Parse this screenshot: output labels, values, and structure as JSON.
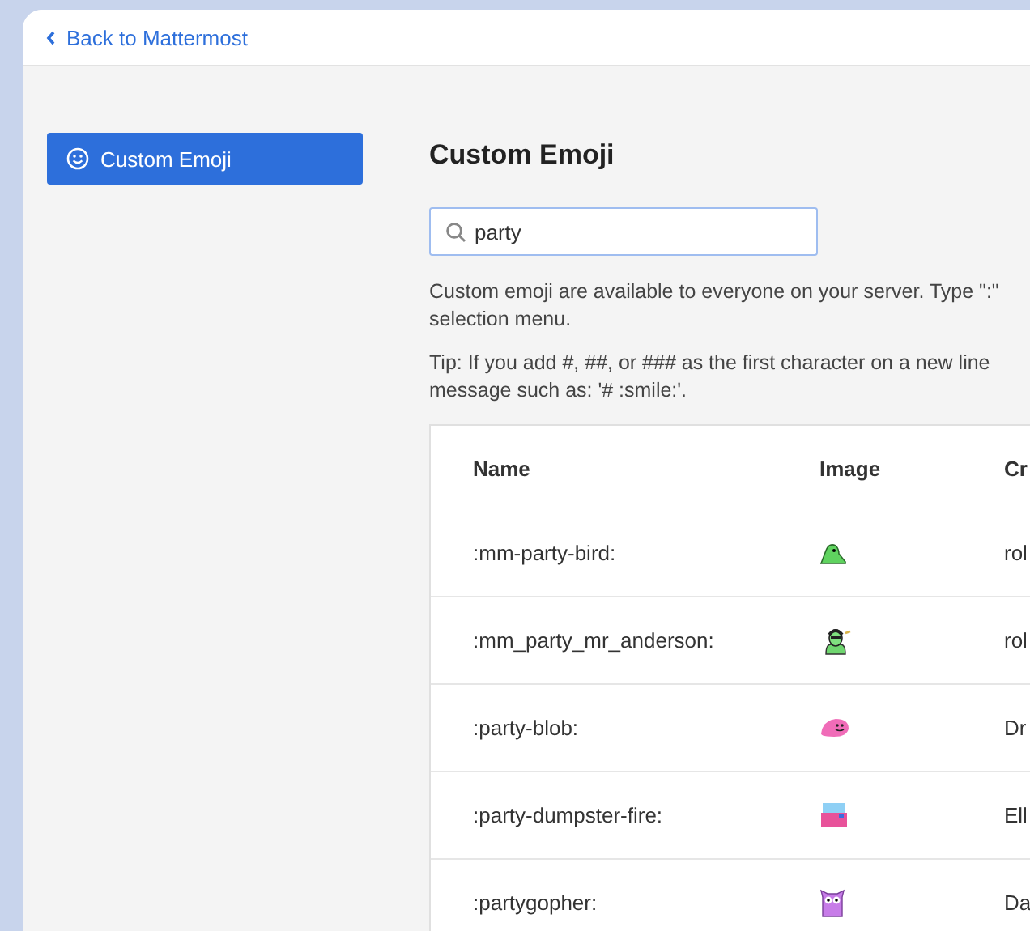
{
  "header": {
    "back_link": "Back to Mattermost"
  },
  "sidebar": {
    "items": [
      {
        "label": "Custom Emoji",
        "selected": true
      }
    ]
  },
  "main": {
    "title": "Custom Emoji",
    "search": {
      "value": "party"
    },
    "description_lines": [
      "Custom emoji are available to everyone on your server. Type \":\"",
      "selection menu."
    ],
    "tip_lines": [
      "Tip: If you add #, ##, or ### as the first character on a new line",
      "message such as: '# :smile:'."
    ],
    "table": {
      "columns": [
        "Name",
        "Image",
        "Cr"
      ],
      "rows": [
        {
          "name": ":mm-party-bird:",
          "kind": "bird",
          "column_3": "rol"
        },
        {
          "name": ":mm_party_mr_anderson:",
          "kind": "face",
          "column_3": "rol"
        },
        {
          "name": ":party-blob:",
          "kind": "blob",
          "column_3": "Dr"
        },
        {
          "name": ":party-dumpster-fire:",
          "kind": "dumpster",
          "column_3": "Ell"
        },
        {
          "name": ":partygopher:",
          "kind": "gopher",
          "column_3": "Da"
        }
      ]
    }
  }
}
